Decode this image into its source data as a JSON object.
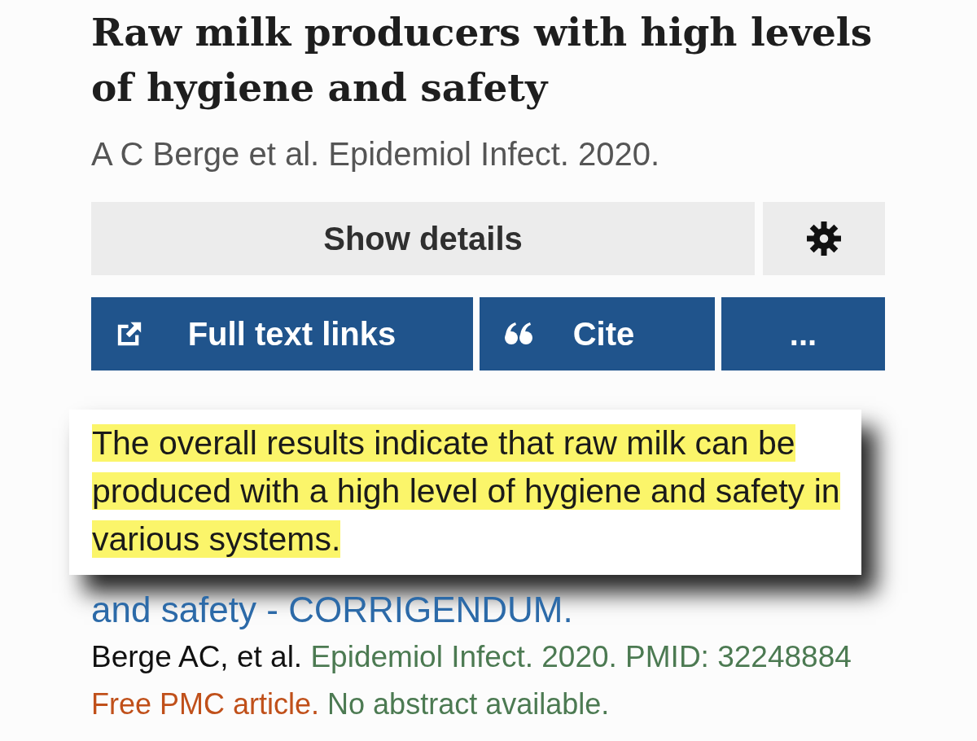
{
  "article": {
    "title": "Raw milk producers with high levels of hygiene and safety",
    "citation": "A C Berge et al. Epidemiol Infect. 2020."
  },
  "toolbar": [
    {
      "kind": "details",
      "label": "Show details"
    },
    {
      "kind": "settings"
    }
  ],
  "actions": [
    {
      "kind": "full_text",
      "label": "Full text links"
    },
    {
      "kind": "cite",
      "label": "Cite"
    },
    {
      "kind": "more",
      "label": "..."
    }
  ],
  "quote": {
    "text": "The overall results indicate that raw milk can be produced with a high level of hygiene and safety in various systems.",
    "highlighted": true
  },
  "related_article": {
    "title": "and safety - CORRIGENDUM.",
    "authors": "Berge AC, et al.",
    "source": "Epidemiol Infect. 2020. PMID: 32248884",
    "free_text": "Free PMC article.",
    "note": "No abstract available."
  }
}
